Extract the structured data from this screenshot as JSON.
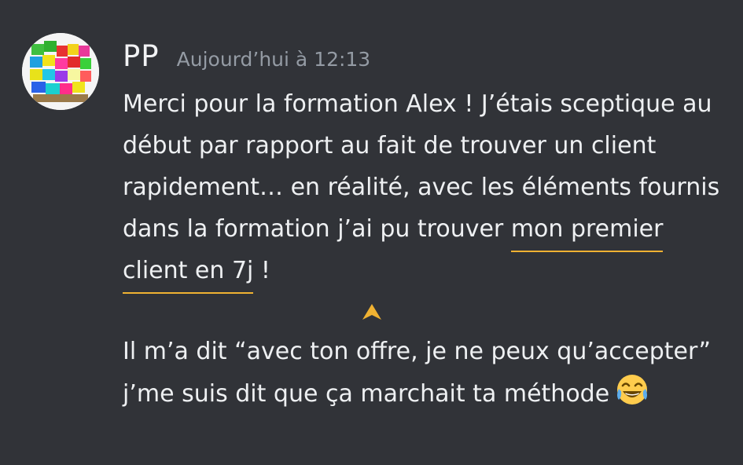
{
  "message": {
    "author": "PP",
    "timestamp": "Aujourd’hui à 12:13",
    "paragraph_1": {
      "before": "Merci pour la formation Alex ! J’étais sceptique au début par rapport au fait de trouver un client rapidement… en réalité, avec les éléments fournis dans la formation j’ai pu trouver ",
      "highlight": "mon premier client en 7j",
      "after": " !"
    },
    "paragraph_2": "Il m’a dit “avec ton offre, je ne peux qu’accepter” j’me suis dit que ça marchait ta méthode",
    "emoji": "joy-emoji",
    "annotation_arrow": "up-arrow-icon"
  },
  "colors": {
    "background": "#313338",
    "text": "#eef0f2",
    "username": "#f2f3f5",
    "timestamp": "#949ba4",
    "highlight_underline": "#f0b232"
  }
}
